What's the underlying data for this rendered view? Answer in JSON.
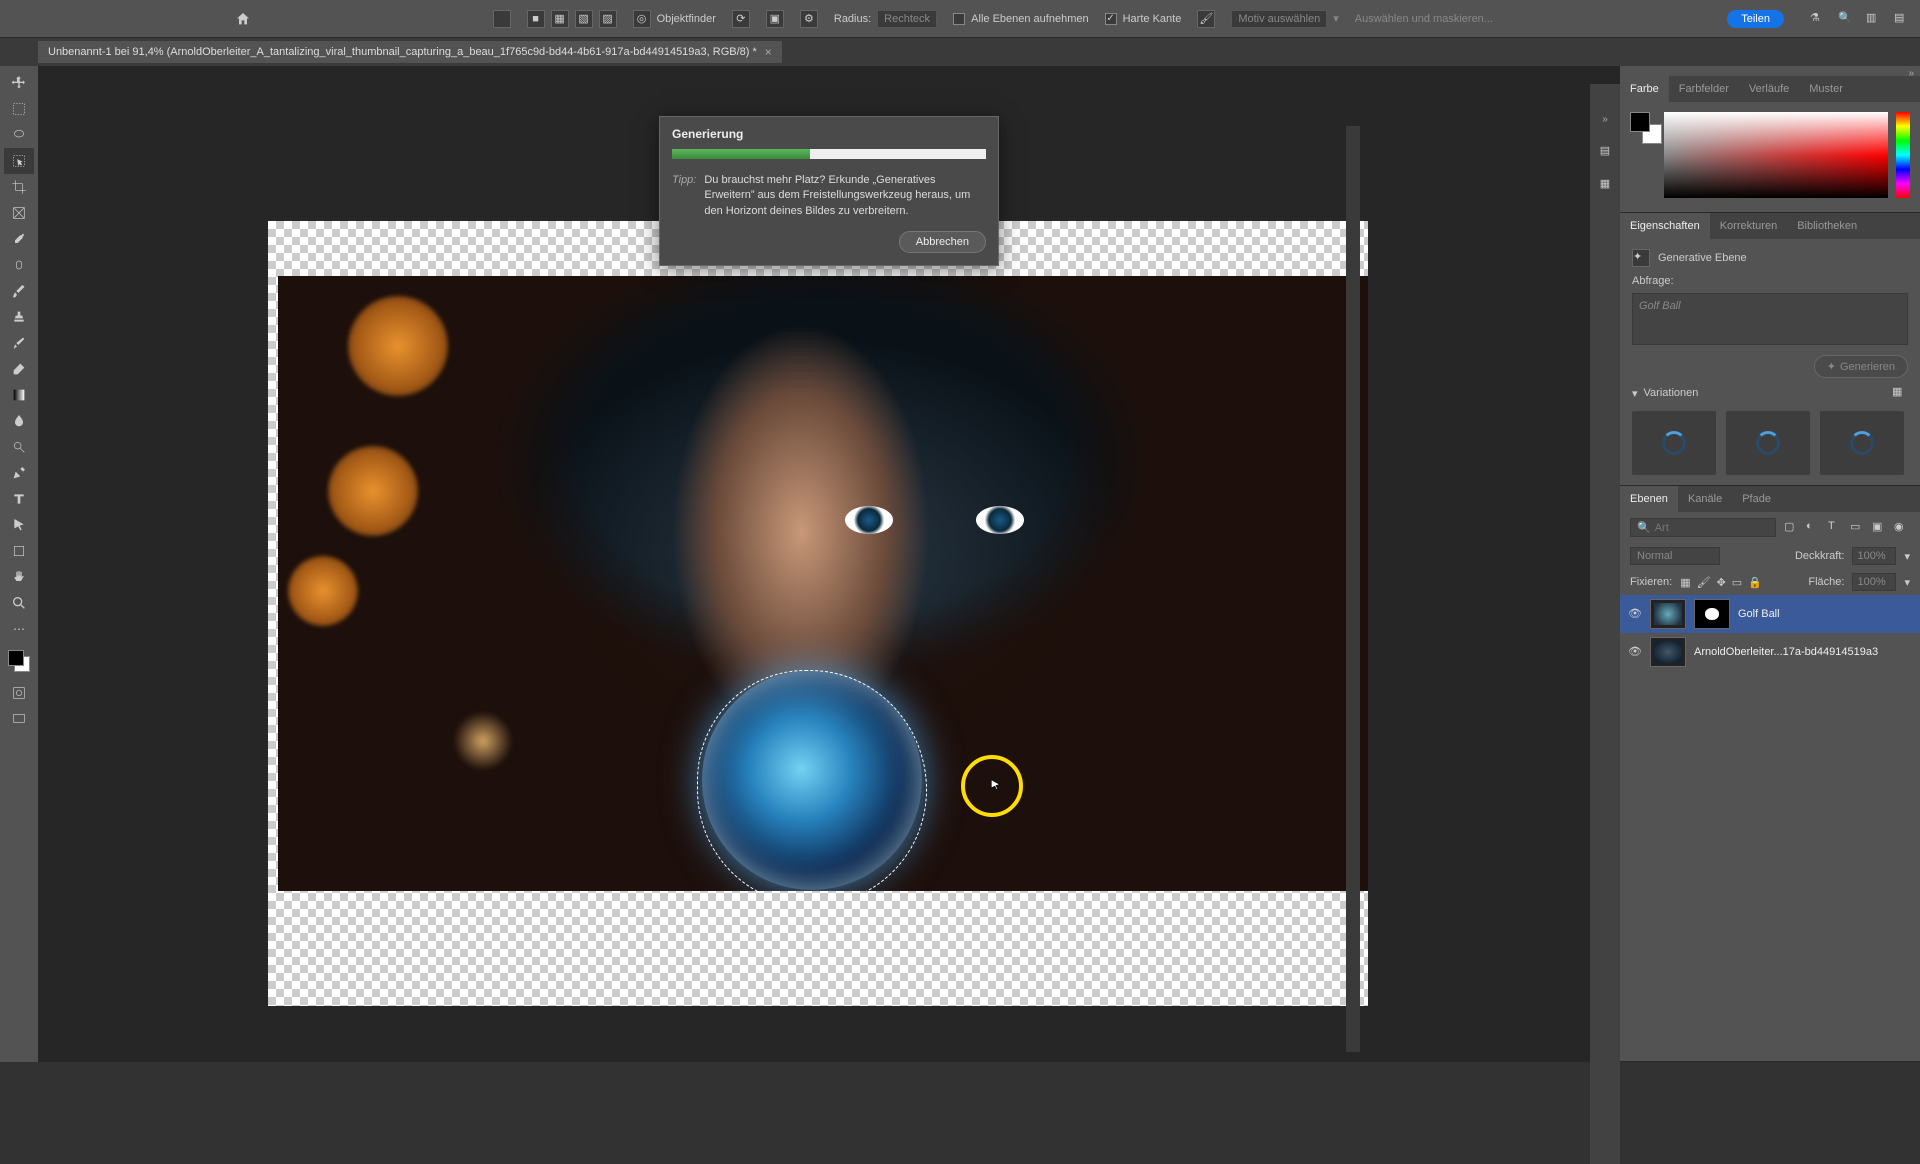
{
  "menubar": {},
  "optionsbar": {
    "objectfinder": "Objektfinder",
    "radius_label": "Radius:",
    "radius_value": "Rechteck",
    "all_layers": "Alle Ebenen aufnehmen",
    "hard_edge": "Harte Kante",
    "subject_select": "Motiv auswählen",
    "select_mask": "Auswählen und maskieren..."
  },
  "share_label": "Teilen",
  "doctab": {
    "title": "Unbenannt-1 bei 91,4% (ArnoldOberleiter_A_tantalizing_viral_thumbnail_capturing_a_beau_1f765c9d-bd44-4b61-917a-bd44914519a3, RGB/8) *"
  },
  "dialog": {
    "title": "Generierung",
    "tip_label": "Tipp:",
    "tip_text": "Du brauchst mehr Platz? Erkunde „Generatives Erweitern” aus dem Freistellungswerkzeug heraus, um den Horizont deines Bildes zu verbreitern.",
    "cancel": "Abbrechen",
    "progress_pct": 44
  },
  "panel_color": {
    "tabs": [
      "Farbe",
      "Farbfelder",
      "Verläufe",
      "Muster"
    ]
  },
  "panel_props": {
    "tabs": [
      "Eigenschaften",
      "Korrekturen",
      "Bibliotheken"
    ],
    "type_label": "Generative Ebene",
    "prompt_label": "Abfrage:",
    "prompt_placeholder": "Golf Ball",
    "generate": "Generieren",
    "variations": "Variationen"
  },
  "panel_layers": {
    "tabs": [
      "Ebenen",
      "Kanäle",
      "Pfade"
    ],
    "search_placeholder": "Art",
    "blend_label": "Normal",
    "opacity_label": "Deckkraft:",
    "opacity_value": "100%",
    "lock_label": "Fixieren:",
    "fill_label": "Fläche:",
    "fill_value": "100%",
    "layers": [
      {
        "name": "Golf Ball"
      },
      {
        "name": "ArnoldOberleiter...17a-bd44914519a3"
      }
    ]
  }
}
